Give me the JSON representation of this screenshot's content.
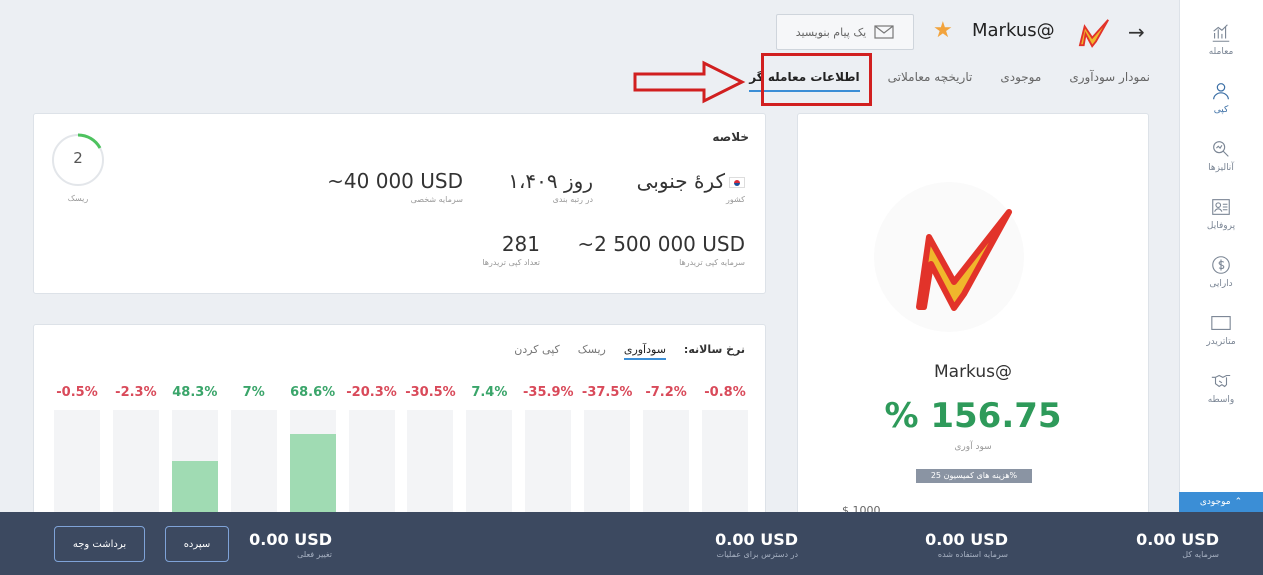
{
  "sidebar": {
    "items": [
      {
        "label": "معامله",
        "icon": "trade-icon"
      },
      {
        "label": "کپی",
        "icon": "copy-user-icon"
      },
      {
        "label": "آنالیزها",
        "icon": "analysis-icon"
      },
      {
        "label": "پروفایل",
        "icon": "profile-icon"
      },
      {
        "label": "دارایی",
        "icon": "dollar-icon"
      },
      {
        "label": "متاتریدر",
        "icon": "metatrader-icon"
      },
      {
        "label": "واسطه",
        "icon": "handshake-icon"
      }
    ],
    "balance_tab": "موجودی"
  },
  "header": {
    "trader_name": "Markus@",
    "message_button": "یک پیام بنویسید"
  },
  "tabs": [
    {
      "label": "نمودار سودآوری"
    },
    {
      "label": "موجودی"
    },
    {
      "label": "تاریخچه معاملاتی"
    },
    {
      "label": "اطلاعات معامله گر"
    }
  ],
  "profile": {
    "name": "Markus@",
    "profit": "% 156.75",
    "profit_caption": "سود آوری",
    "commission": "هزینه های کمیسیون 25%",
    "text": "... $ 1000 ..."
  },
  "summary": {
    "title": "خلاصه",
    "risk_value": "2",
    "risk_label": "ریسک",
    "country": "کرهٔ جنوبی",
    "country_label": "کشور",
    "days": "۱،۴۰۹ روز",
    "days_label": "در رتبه بندی",
    "personal_capital": "~40 000 USD",
    "personal_capital_label": "سرمایه شخصی",
    "copy_capital": "~2 500 000 USD",
    "copy_capital_label": "سرمایه کپی تریدرها",
    "copiers": "281",
    "copiers_label": "تعداد کپی تریدرها"
  },
  "chart_section": {
    "title": "نرخ سالانه:",
    "tabs": [
      "سودآوری",
      "ریسک",
      "کپی کردن"
    ]
  },
  "chart_data": {
    "type": "bar",
    "values": [
      -0.5,
      -2.3,
      48.3,
      7,
      68.6,
      -20.3,
      -30.5,
      7.4,
      -35.9,
      -37.5,
      -7.2,
      -0.8
    ],
    "labels": [
      "-0.5%",
      "-2.3%",
      "48.3%",
      "7%",
      "68.6%",
      "-20.3%",
      "-30.5%",
      "7.4%",
      "-35.9%",
      "-37.5%",
      "-7.2%",
      "-0.8%"
    ]
  },
  "bottom": {
    "balance": "0.00 USD",
    "balance_label": "سرمایه کل",
    "used": "0.00 USD",
    "used_label": "سرمایه استفاده شده",
    "available": "0.00 USD",
    "available_label": "در دسترس برای عملیات",
    "change": "0.00 USD",
    "change_label": "تغییر فعلی",
    "deposit": "سپرده",
    "withdraw": "برداشت وجه"
  }
}
